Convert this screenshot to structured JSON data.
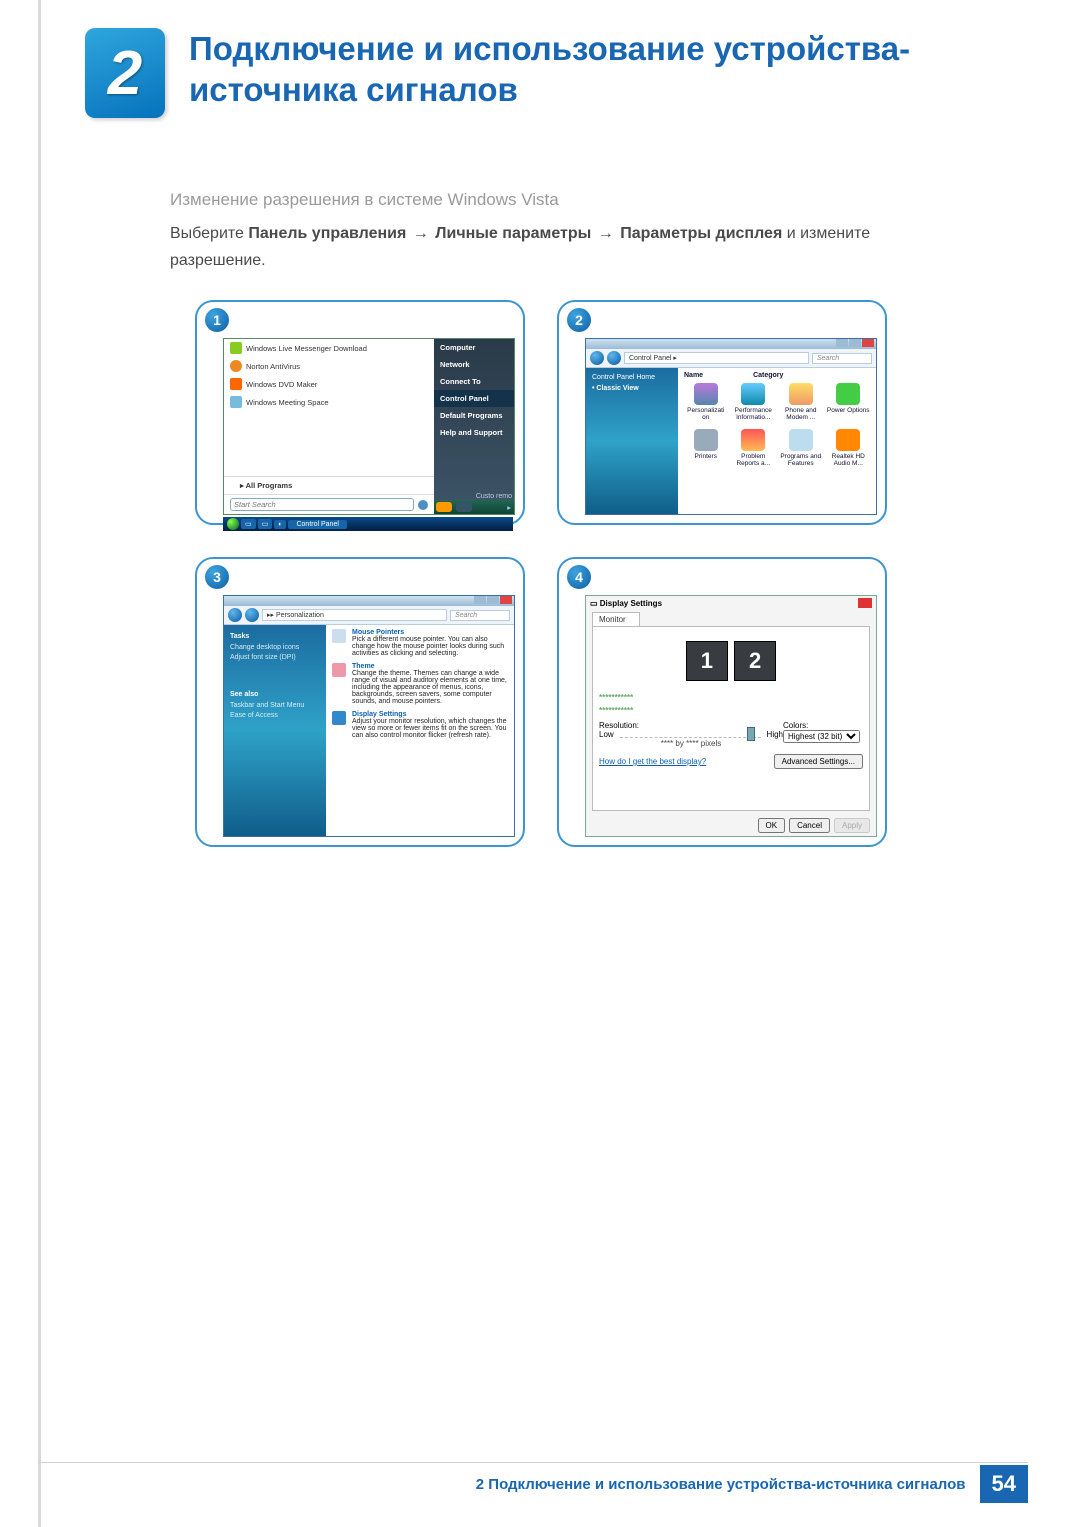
{
  "chapter": {
    "number": "2",
    "title": "Подключение и использование устройства-источника сигналов"
  },
  "section_title": "Изменение разрешения в системе Windows Vista",
  "body": {
    "lead_in": "Выберите ",
    "path1": "Панель управления",
    "arrow": "→",
    "path2": "Личные параметры",
    "path3": "Параметры дисплея",
    "trail": " и измените разрешение."
  },
  "steps": {
    "s1": "1",
    "s2": "2",
    "s3": "3",
    "s4": "4"
  },
  "shot1": {
    "items": [
      "Windows Live Messenger Download",
      "Norton AntiVirus",
      "Windows DVD Maker",
      "Windows Meeting Space"
    ],
    "all_programs": "All Programs",
    "search_placeholder": "Start Search",
    "right": [
      "Computer",
      "Network",
      "Connect To",
      "Control Panel",
      "Default Programs",
      "Help and Support"
    ],
    "right_note": "Custo remo",
    "taskbar_label": "Control Panel"
  },
  "shot2": {
    "breadcrumb": "Control Panel  ▸",
    "search_placeholder": "Search",
    "side_home": "Control Panel Home",
    "side_classic": "Classic View",
    "col_name": "Name",
    "col_category": "Category",
    "cells": [
      "Personalizati\non",
      "Performance Informatio...",
      "Phone and Modem ...",
      "Power Options",
      "Printers",
      "Problem Reports a...",
      "Programs and Features",
      "Realtek HD Audio M..."
    ]
  },
  "shot3": {
    "breadcrumb": "  ▸▸ Personalization",
    "search_placeholder": "Search",
    "side": {
      "tasks": "Tasks",
      "i1": "Change desktop icons",
      "i2": "Adjust font size (DPI)",
      "seealso": "See also",
      "sa1": "Taskbar and Start Menu",
      "sa2": "Ease of Access"
    },
    "items": [
      {
        "t": "Mouse Pointers",
        "d": "Pick a different mouse pointer. You can also change how the mouse pointer looks during such activities as clicking and selecting."
      },
      {
        "t": "Theme",
        "d": "Change the theme. Themes can change a wide range of visual and auditory elements at one time, including the appearance of menus, icons, backgrounds, screen savers, some computer sounds, and mouse pointers."
      },
      {
        "t": "Display Settings",
        "d": "Adjust your monitor resolution, which changes the view so more or fewer items fit on the screen. You can also control monitor flicker (refresh rate)."
      }
    ]
  },
  "shot4": {
    "title": "Display Settings",
    "tab": "Monitor",
    "mon1": "1",
    "mon2": "2",
    "stars1": "***********",
    "stars2": "***********",
    "res_label": "Resolution:",
    "low": "Low",
    "high": "High",
    "pixels": "**** by **** pixels",
    "colors_label": "Colors:",
    "colors_value": "Highest (32 bit)",
    "help": "How do I get the best display?",
    "adv": "Advanced Settings...",
    "ok": "OK",
    "cancel": "Cancel",
    "apply": "Apply"
  },
  "footer": {
    "text": "2 Подключение и использование устройства-источника сигналов",
    "page": "54"
  }
}
